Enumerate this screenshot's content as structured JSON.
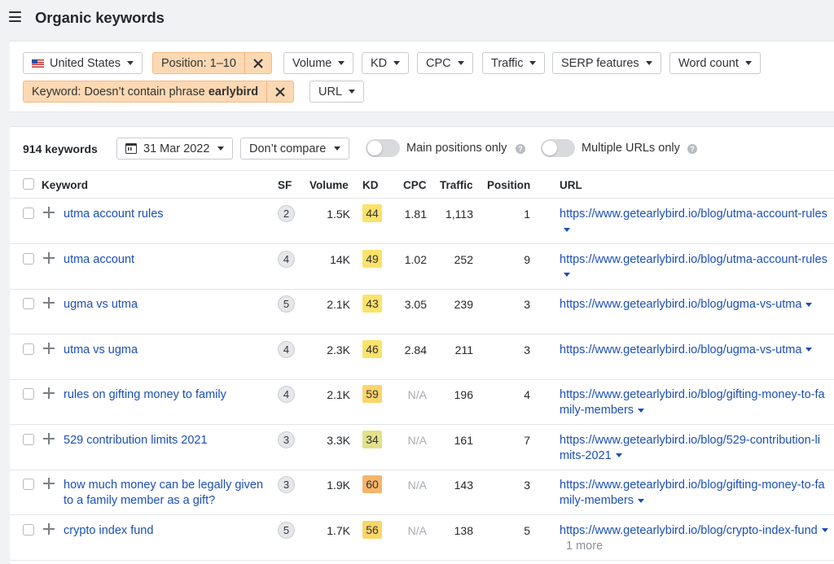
{
  "header": {
    "title": "Organic keywords"
  },
  "filters": {
    "country": "United States",
    "position": "Position: 1–10",
    "volume": "Volume",
    "kd": "KD",
    "cpc": "CPC",
    "traffic": "Traffic",
    "serp": "SERP features",
    "wordcount": "Word count",
    "keyword_prefix": "Keyword: Doesn’t contain phrase ",
    "keyword_term": "earlybird",
    "url": "URL"
  },
  "toolbar": {
    "count": "914 keywords",
    "date": "31 Mar 2022",
    "compare": "Don’t compare",
    "main_positions": "Main positions only",
    "multiple_urls": "Multiple URLs only"
  },
  "columns": {
    "keyword": "Keyword",
    "sf": "SF",
    "volume": "Volume",
    "kd": "KD",
    "cpc": "CPC",
    "traffic": "Traffic",
    "position": "Position",
    "url": "URL"
  },
  "kd_colors": {
    "yellow": "#fbe26a",
    "light": "#ecdd7a",
    "orange": "#f7b56b"
  },
  "rows": [
    {
      "keyword": "utma account rules",
      "sf": "2",
      "volume": "1.5K",
      "kd": "44",
      "kd_color": "#fbe26a",
      "cpc": "1.81",
      "traffic": "1,113",
      "position": "1",
      "url": "https://www.getearlybird.io/blog/utma-account-rules",
      "more": ""
    },
    {
      "keyword": "utma account",
      "sf": "4",
      "volume": "14K",
      "kd": "49",
      "kd_color": "#fbe26a",
      "cpc": "1.02",
      "traffic": "252",
      "position": "9",
      "url": "https://www.getearlybird.io/blog/utma-account-rules",
      "more": ""
    },
    {
      "keyword": "ugma vs utma",
      "sf": "5",
      "volume": "2.1K",
      "kd": "43",
      "kd_color": "#fbe26a",
      "cpc": "3.05",
      "traffic": "239",
      "position": "3",
      "url": "https://www.getearlybird.io/blog/ugma-vs-utma",
      "more": ""
    },
    {
      "keyword": "utma vs ugma",
      "sf": "4",
      "volume": "2.3K",
      "kd": "46",
      "kd_color": "#fbe26a",
      "cpc": "2.84",
      "traffic": "211",
      "position": "3",
      "url": "https://www.getearlybird.io/blog/ugma-vs-utma",
      "more": ""
    },
    {
      "keyword": "rules on gifting money to family",
      "sf": "4",
      "volume": "2.1K",
      "kd": "59",
      "kd_color": "#fbd56a",
      "cpc": "N/A",
      "traffic": "196",
      "position": "4",
      "url": "https://www.getearlybird.io/blog/gifting-money-to-family-members",
      "more": ""
    },
    {
      "keyword": "529 contribution limits 2021",
      "sf": "3",
      "volume": "3.3K",
      "kd": "34",
      "kd_color": "#e3e08a",
      "cpc": "N/A",
      "traffic": "161",
      "position": "7",
      "url": "https://www.getearlybird.io/blog/529-contribution-limits-2021",
      "more": ""
    },
    {
      "keyword": "how much money can be legally given to a family member as a gift?",
      "sf": "3",
      "volume": "1.9K",
      "kd": "60",
      "kd_color": "#f7b56b",
      "cpc": "N/A",
      "traffic": "143",
      "position": "3",
      "url": "https://www.getearlybird.io/blog/gifting-money-to-family-members",
      "more": ""
    },
    {
      "keyword": "crypto index fund",
      "sf": "5",
      "volume": "1.7K",
      "kd": "56",
      "kd_color": "#fbd56a",
      "cpc": "N/A",
      "traffic": "138",
      "position": "5",
      "url": "https://www.getearlybird.io/blog/crypto-index-fund",
      "more": "1 more"
    }
  ]
}
